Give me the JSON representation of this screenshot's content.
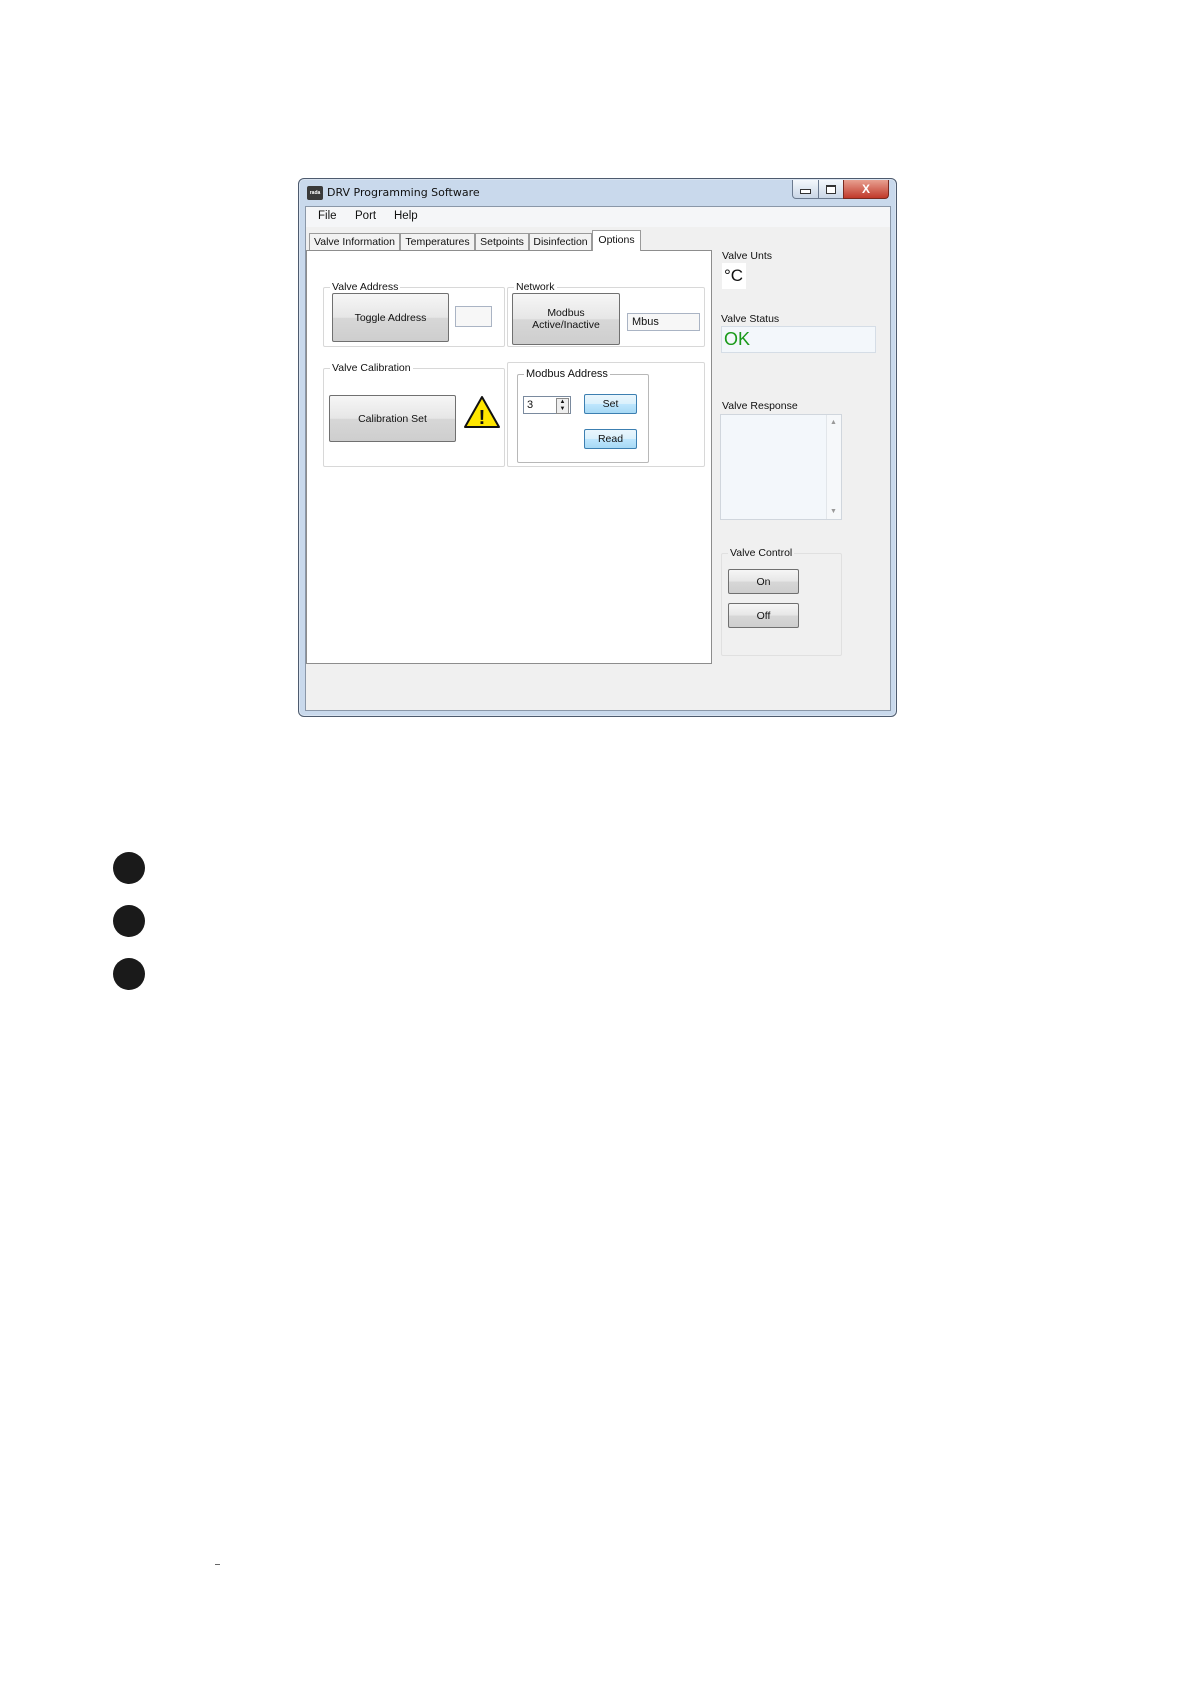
{
  "window": {
    "title": "DRV Programming Software",
    "icon_text": "rada",
    "controls": {
      "minimize": "minimize-icon",
      "maximize": "maximize-icon",
      "close": "X"
    }
  },
  "menu": [
    "File",
    "Port",
    "Help"
  ],
  "tabs": [
    "Valve Information",
    "Temperatures",
    "Setpoints",
    "Disinfection",
    "Options"
  ],
  "active_tab": "Options",
  "options_page": {
    "valve_address": {
      "legend": "Valve Address",
      "toggle_button": "Toggle Address",
      "address_value": ""
    },
    "network": {
      "legend": "Network",
      "modbus_button_line1": "Modbus",
      "modbus_button_line2": "Active/Inactive",
      "mode_value": "Mbus"
    },
    "valve_calibration": {
      "legend": "Valve Calibration",
      "calibration_button": "Calibration Set",
      "warning_glyph": "!"
    },
    "modbus_address": {
      "legend": "Modbus Address",
      "value": "3",
      "set_button": "Set",
      "read_button": "Read"
    }
  },
  "side": {
    "units_label": "Valve Unts",
    "units_value": "°C",
    "status_label": "Valve Status",
    "status_value": "OK",
    "response_label": "Valve Response",
    "response_value": "",
    "control_legend": "Valve Control",
    "on_button": "On",
    "off_button": "Off"
  },
  "colors": {
    "status_ok": "#1a9a1a",
    "close_button": "#c0392b",
    "window_frame": "#c9d9ec"
  }
}
